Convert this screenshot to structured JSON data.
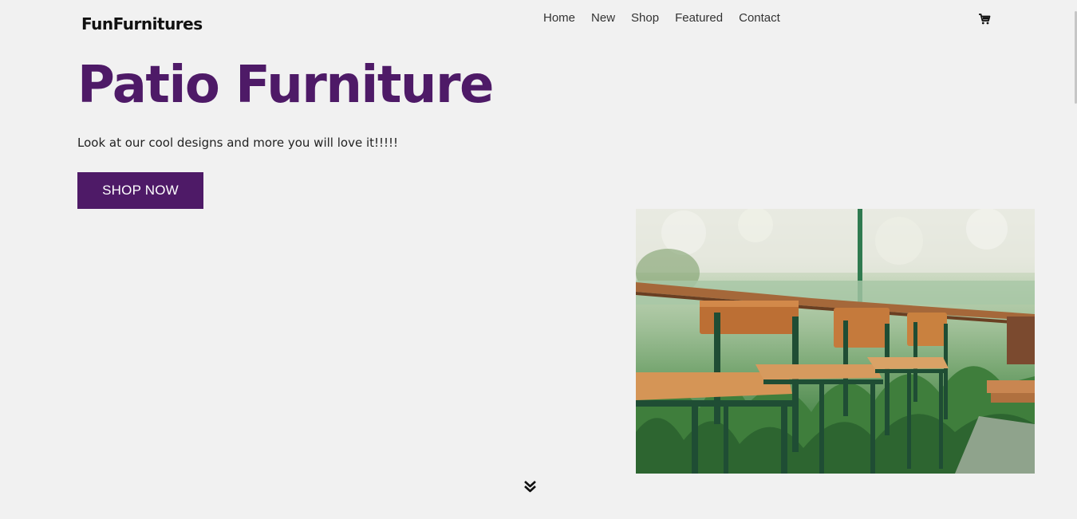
{
  "brand": {
    "logo_text": "FunFurnitures"
  },
  "nav": {
    "items": [
      {
        "label": "Home"
      },
      {
        "label": "New"
      },
      {
        "label": "Shop"
      },
      {
        "label": "Featured"
      },
      {
        "label": "Contact"
      }
    ],
    "cart_icon": "shopping-cart-icon"
  },
  "hero": {
    "title": "Patio Furniture",
    "subtitle": "Look at our cool designs and more you will love it!!!!!",
    "cta_label": "SHOP NOW",
    "image_alt_subject": "wooden bar stools on patio",
    "scroll_icon": "double-chevron-down-icon"
  },
  "colors": {
    "brand_purple": "#4e1a67",
    "background": "#f1f1f1",
    "text": "#222222"
  }
}
